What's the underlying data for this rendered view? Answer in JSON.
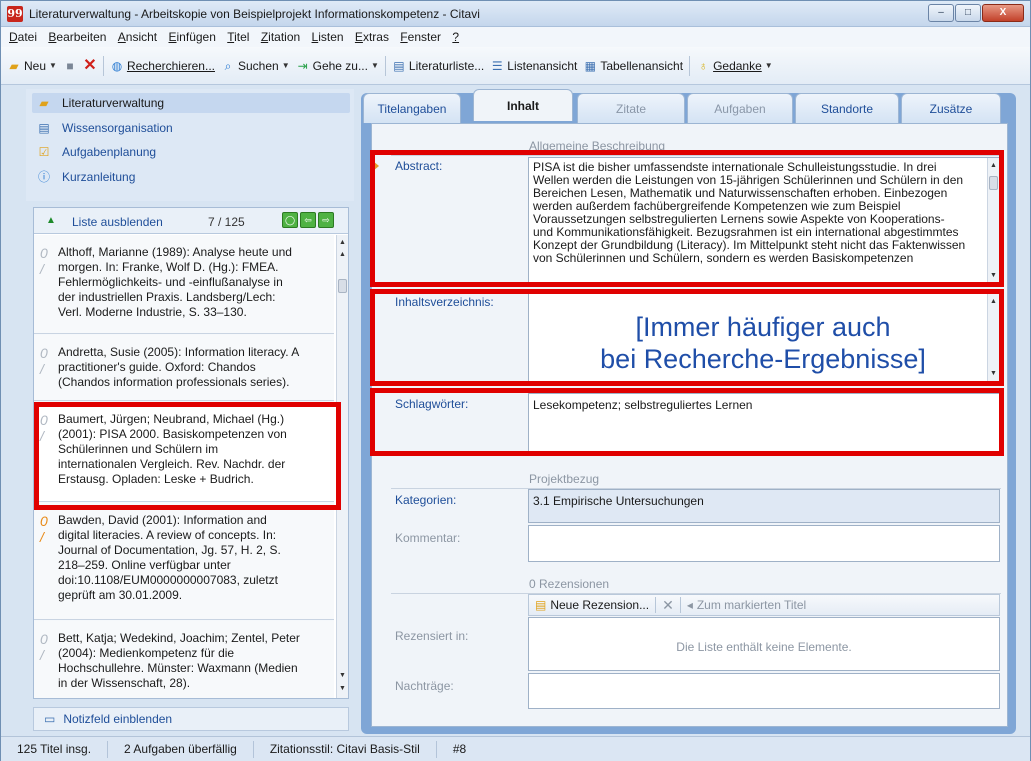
{
  "window": {
    "app_icon_glyph": "99",
    "title": "Literaturverwaltung - Arbeitskopie von Beispielprojekt Informationskompetenz - Citavi",
    "buttons": {
      "minimize": "–",
      "maximize": "□",
      "close": "X"
    }
  },
  "menu": [
    {
      "label": "Datei",
      "u": "D",
      "rest": "atei"
    },
    {
      "label": "Bearbeiten",
      "u": "B",
      "rest": "earbeiten"
    },
    {
      "label": "Ansicht",
      "u": "A",
      "rest": "nsicht"
    },
    {
      "label": "Einfügen",
      "u": "E",
      "rest": "infügen"
    },
    {
      "label": "Titel",
      "u": "T",
      "rest": "itel"
    },
    {
      "label": "Zitation",
      "u": "Z",
      "rest": "itation"
    },
    {
      "label": "Listen",
      "u": "L",
      "rest": "isten"
    },
    {
      "label": "Extras",
      "u": "E",
      "rest": "xtras"
    },
    {
      "label": "Fenster",
      "u": "F",
      "rest": "enster"
    },
    {
      "label": "?",
      "u": "?",
      "rest": ""
    }
  ],
  "toolbar": {
    "new_label": "Neu",
    "search_label": "Recherchieren...",
    "find_label": "Suchen",
    "goto_label": "Gehe zu...",
    "literature_list_label": "Literaturliste...",
    "list_view_label": "Listenansicht",
    "table_view_label": "Tabellenansicht",
    "thought_label": "Gedanke"
  },
  "left_nav": [
    {
      "label": "Literaturverwaltung",
      "icon": "folder-icon"
    },
    {
      "label": "Wissensorganisation",
      "icon": "notes-icon"
    },
    {
      "label": "Aufgabenplanung",
      "icon": "task-icon"
    },
    {
      "label": "Kurzanleitung",
      "icon": "info-icon"
    }
  ],
  "list": {
    "hide_label": "Liste ausblenden",
    "position": "7 / 125",
    "records": [
      {
        "lines": [
          "Althoff, Marianne (1989): Analyse heute und",
          "morgen. In: Franke, Wolf D. (Hg.): FMEA.",
          "Fehlermöglichkeits- und -einflußanalyse in",
          "der industriellen Praxis. Landsberg/Lech:",
          "Verl. Moderne Industrie, S. 33–130."
        ]
      },
      {
        "lines": [
          "Andretta, Susie (2005): Information literacy. A",
          "practitioner's guide. Oxford: Chandos",
          "(Chandos information professionals series)."
        ]
      },
      {
        "lines": [
          "Baumert, Jürgen; Neubrand, Michael (Hg.)",
          "(2001): PISA 2000. Basiskompetenzen von",
          "Schülerinnen und Schülern im",
          "internationalen Vergleich. Rev. Nachdr. der",
          "Erstausg. Opladen: Leske + Budrich."
        ]
      },
      {
        "lines": [
          "Bawden, David (2001): Information and",
          "digital literacies. A review of concepts. In:",
          "Journal of Documentation, Jg. 57, H. 2, S.",
          "218–259. Online verfügbar unter",
          "doi:10.1108/EUM0000000007083, zuletzt",
          "geprüft am 30.01.2009."
        ]
      },
      {
        "lines": [
          "Bett, Katja; Wedekind, Joachim; Zentel, Peter",
          "(2004): Medienkompetenz für die",
          "Hochschullehre. Münster: Waxmann (Medien",
          "in der Wissenschaft, 28)."
        ]
      }
    ]
  },
  "notiz_label": "Notizfeld einblenden",
  "tabs": [
    "Titelangaben",
    "Inhalt",
    "Zitate",
    "Aufgaben",
    "Standorte",
    "Zusätze"
  ],
  "content": {
    "section_general": "Allgemeine Beschreibung",
    "abstract_label": "Abstract:",
    "abstract_lines": [
      "PISA ist die bisher umfassendste internationale Schulleistungsstudie. In drei",
      "Wellen werden die Leistungen von 15-jährigen Schülerinnen und Schülern in den",
      "Bereichen Lesen, Mathematik und Naturwissenschaften erhoben. Einbezogen",
      "werden außerdem fachübergreifende Kompetenzen wie zum Beispiel",
      "Voraussetzungen selbstregulierten Lernens sowie Aspekte von Kooperations-",
      "und Kommunikationsfähigkeit. Bezugsrahmen ist ein international abgestimmtes",
      "Konzept der Grundbildung (Literacy). Im Mittelpunkt steht nicht das Faktenwissen",
      "von Schülerinnen und Schülern, sondern es werden Basiskompetenzen"
    ],
    "toc_label": "Inhaltsverzeichnis:",
    "overlay_line1": "[Immer häufiger auch",
    "overlay_line2": "bei Recherche-Ergebnisse]",
    "keywords_label": "Schlagwörter:",
    "keywords_value": "Lesekompetenz; selbstreguliertes Lernen",
    "section_project": "Projektbezug",
    "categories_label": "Kategorien:",
    "categories_value": "3.1 Empirische Untersuchungen",
    "comment_label": "Kommentar:",
    "section_reviews": "0 Rezensionen",
    "new_review_label": "Neue Rezension...",
    "to_marked_label": "Zum markierten Titel",
    "reviewed_in_label": "Rezensiert in:",
    "empty_list_text": "Die Liste enthält keine Elemente.",
    "addenda_label": "Nachträge:"
  },
  "status": [
    "125 Titel insg.",
    "2 Aufgaben überfällig",
    "Zitationsstil: Citavi Basis-Stil",
    "#8"
  ],
  "colors": {
    "accent": "#1f4e99",
    "highlight": "#e00000",
    "panel": "#7fa6d6"
  }
}
